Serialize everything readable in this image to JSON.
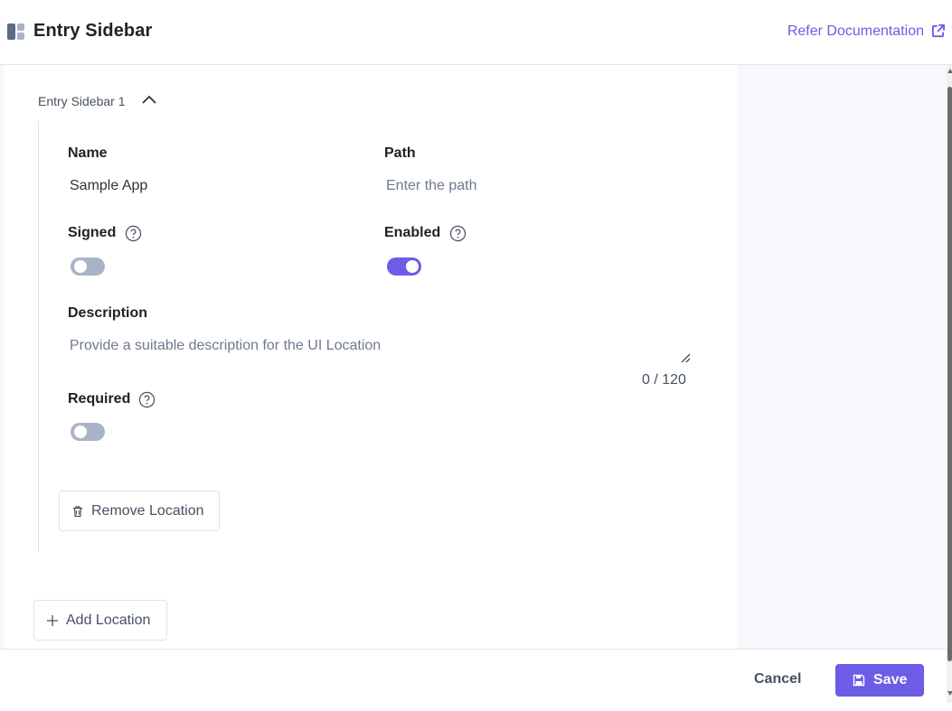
{
  "header": {
    "title": "Entry Sidebar",
    "doc_link": "Refer Documentation",
    "icon": "layout-sidebar-icon",
    "link_icon": "external-link-icon"
  },
  "section": {
    "title": "Entry Sidebar 1",
    "toggle_icon": "chevron-up-icon"
  },
  "fields": {
    "name": {
      "label": "Name",
      "value": "Sample App"
    },
    "path": {
      "label": "Path",
      "placeholder": "Enter the path"
    },
    "signed": {
      "label": "Signed",
      "enabled": false,
      "help_icon": "help-icon"
    },
    "enabled": {
      "label": "Enabled",
      "enabled": true,
      "help_icon": "help-icon"
    },
    "description": {
      "label": "Description",
      "placeholder": "Provide a suitable description for the UI Location",
      "counter": "0 / 120"
    },
    "required": {
      "label": "Required",
      "enabled": false,
      "help_icon": "help-icon"
    }
  },
  "actions": {
    "remove_location": "Remove Location",
    "add_location": "Add Location"
  },
  "footer": {
    "cancel": "Cancel",
    "save": "Save"
  },
  "colors": {
    "accent": "#6c5ce7",
    "toggle_off": "#a9b3c8",
    "panel_bg": "#f7f8fb"
  }
}
